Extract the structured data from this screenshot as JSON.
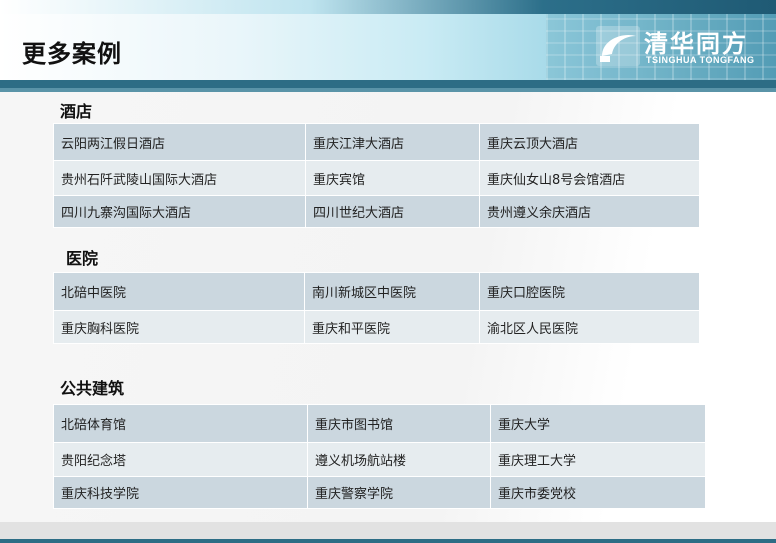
{
  "header": {
    "title": "更多案例",
    "logo_cn": "清华同方",
    "logo_en": "TSINGHUA TONGFANG"
  },
  "sections": [
    {
      "title": "酒店",
      "rows": [
        [
          "云阳两江假日酒店",
          "重庆江津大酒店",
          "重庆云顶大酒店"
        ],
        [
          "贵州石阡武陵山国际大酒店",
          "重庆宾馆",
          "重庆仙女山8号会馆酒店"
        ],
        [
          "四川九寨沟国际大酒店",
          "四川世纪大酒店",
          "贵州遵义余庆酒店"
        ]
      ]
    },
    {
      "title": "医院",
      "rows": [
        [
          "北碚中医院",
          "南川新城区中医院",
          "重庆口腔医院"
        ],
        [
          "重庆胸科医院",
          "重庆和平医院",
          "渝北区人民医院"
        ]
      ]
    },
    {
      "title": "公共建筑",
      "rows": [
        [
          "北碚体育馆",
          "重庆市图书馆",
          "重庆大学"
        ],
        [
          "贵阳纪念塔",
          "遵义机场航站楼",
          "重庆理工大学"
        ],
        [
          "重庆科技学院",
          "重庆警察学院",
          "重庆市委党校"
        ]
      ]
    }
  ],
  "colors": {
    "row_dark": "#cbd7df",
    "row_light": "#e6ecef",
    "accent": "#2d6d85"
  }
}
